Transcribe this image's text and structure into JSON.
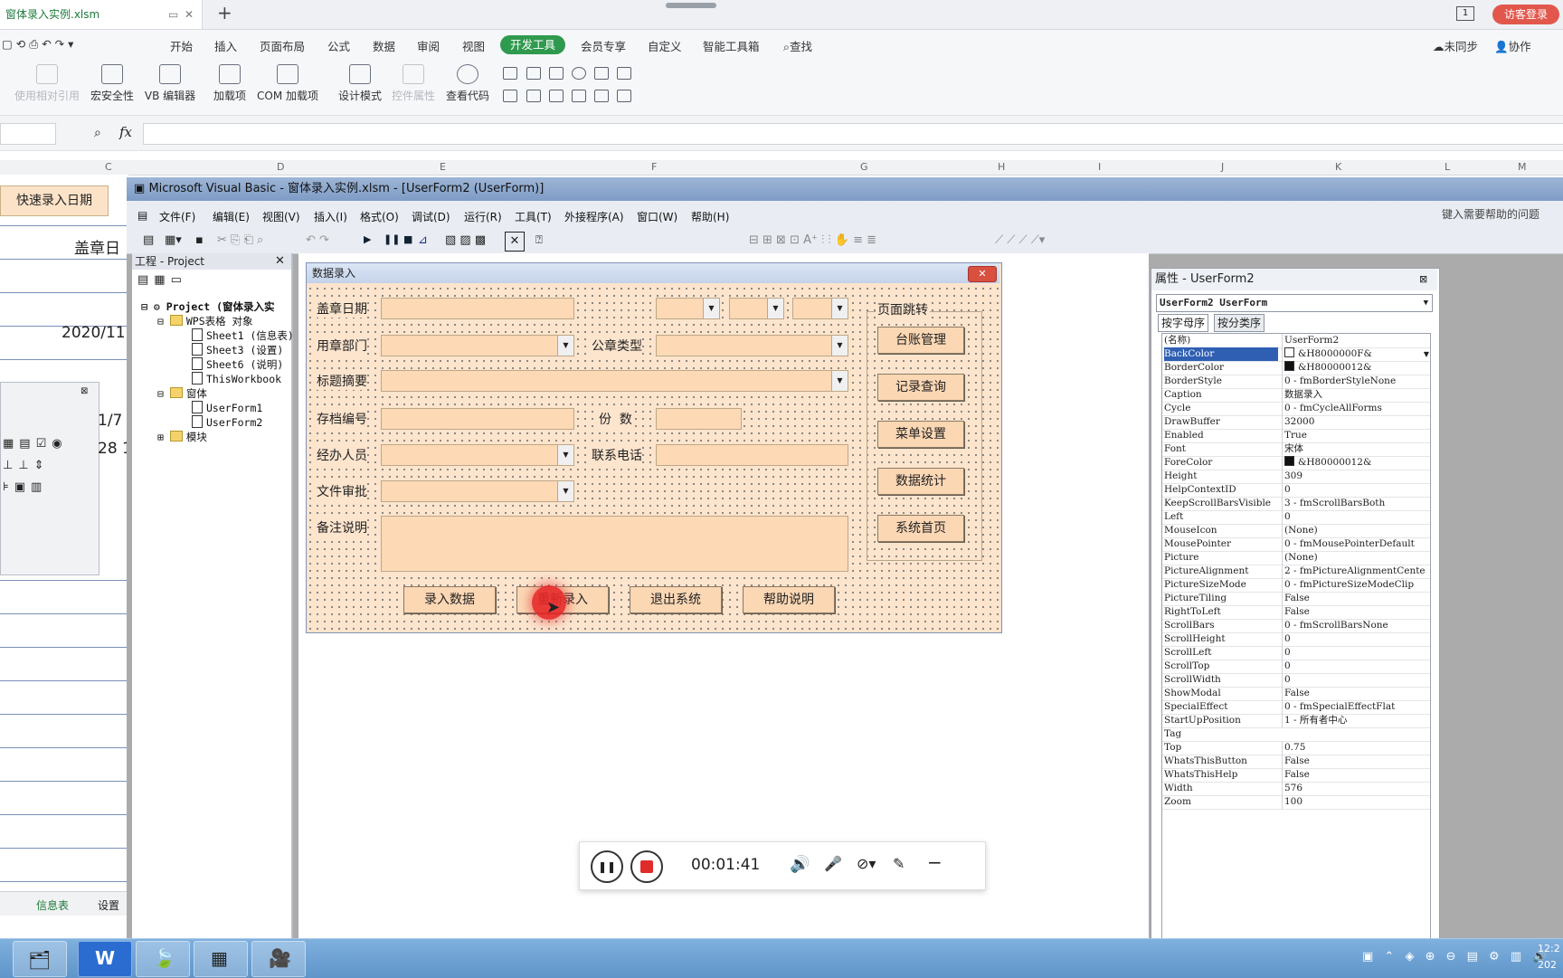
{
  "wps": {
    "tab_title": "窗体录入实例.xlsm",
    "guest_label": "访客登录",
    "window_count": "1",
    "menu": [
      "开始",
      "插入",
      "页面布局",
      "公式",
      "数据",
      "审阅",
      "视图"
    ],
    "menu_active": "开发工具",
    "menu_after": [
      "会员专享",
      "自定义",
      "智能工具箱"
    ],
    "search_label": "查找",
    "sync_label": "未同步",
    "collab_label": "协作",
    "ribbon": [
      {
        "label": "使用相对引用",
        "disabled": true
      },
      {
        "label": "宏安全性",
        "disabled": false
      },
      {
        "label": "VB 编辑器",
        "disabled": false
      },
      {
        "label": "加载项",
        "disabled": false
      },
      {
        "label": "COM 加载项",
        "disabled": false
      },
      {
        "label": "设计模式",
        "disabled": false
      },
      {
        "label": "控件属性",
        "disabled": true
      },
      {
        "label": "查看代码",
        "disabled": false
      }
    ],
    "fx_label": "fx",
    "columns": [
      "C",
      "D",
      "E",
      "F",
      "G",
      "H",
      "I",
      "J",
      "K",
      "L",
      "M"
    ],
    "sheet": {
      "quick_btn": "快速录入日期",
      "cell_header": "盖章日",
      "cell_date": "2020/11",
      "cell_partial1": "1/7",
      "cell_partial2": "28 1"
    },
    "sheet_tabs": [
      "信息表",
      "设置"
    ]
  },
  "vbe": {
    "title": "Microsoft Visual Basic - 窗体录入实例.xlsm - [UserForm2 (UserForm)]",
    "menu": [
      "文件(F)",
      "编辑(E)",
      "视图(V)",
      "插入(I)",
      "格式(O)",
      "调试(D)",
      "运行(R)",
      "工具(T)",
      "外接程序(A)",
      "窗口(W)",
      "帮助(H)"
    ],
    "help_placeholder": "键入需要帮助的问题",
    "project": {
      "title": "工程 - Project",
      "root": "Project (窗体录入实",
      "wps_objects": "WPS表格 对象",
      "sheets": [
        "Sheet1 (信息表)",
        "Sheet3 (设置)",
        "Sheet6 (说明)",
        "ThisWorkbook"
      ],
      "forms_folder": "窗体",
      "forms": [
        "UserForm1",
        "UserForm2"
      ],
      "modules_folder": "模块"
    }
  },
  "userform": {
    "caption": "数据录入",
    "close_glyph": "✕",
    "labels": {
      "seal_date": "盖章日期",
      "dept": "用章部门",
      "seal_type": "公章类型",
      "summary": "标题摘要",
      "archive_no": "存档编号",
      "copies": "份  数",
      "handler": "经办人员",
      "phone": "联系电话",
      "approval": "文件审批",
      "remarks": "备注说明"
    },
    "frame_caption": "页面跳转",
    "frame_buttons": [
      "台账管理",
      "记录查询",
      "菜单设置",
      "数据统计",
      "系统首页"
    ],
    "bottom_buttons": [
      "录入数据",
      "重新录入",
      "退出系统",
      "帮助说明"
    ]
  },
  "properties": {
    "title": "属性 - UserForm2",
    "object": "UserForm2 UserForm",
    "tabs": [
      "按字母序",
      "按分类序"
    ],
    "rows": [
      {
        "name": "(名称)",
        "value": "UserForm2"
      },
      {
        "name": "BackColor",
        "value": "&H8000000F&",
        "swatch": "#ffffff",
        "selected": true
      },
      {
        "name": "BorderColor",
        "value": "&H80000012&",
        "swatch": "#111111"
      },
      {
        "name": "BorderStyle",
        "value": "0 - fmBorderStyleNone"
      },
      {
        "name": "Caption",
        "value": "数据录入"
      },
      {
        "name": "Cycle",
        "value": "0 - fmCycleAllForms"
      },
      {
        "name": "DrawBuffer",
        "value": "32000"
      },
      {
        "name": "Enabled",
        "value": "True"
      },
      {
        "name": "Font",
        "value": "宋体"
      },
      {
        "name": "ForeColor",
        "value": "&H80000012&",
        "swatch": "#111111"
      },
      {
        "name": "Height",
        "value": "309"
      },
      {
        "name": "HelpContextID",
        "value": "0"
      },
      {
        "name": "KeepScrollBarsVisible",
        "value": "3 - fmScrollBarsBoth"
      },
      {
        "name": "Left",
        "value": "0"
      },
      {
        "name": "MouseIcon",
        "value": "(None)"
      },
      {
        "name": "MousePointer",
        "value": "0 - fmMousePointerDefault"
      },
      {
        "name": "Picture",
        "value": "(None)"
      },
      {
        "name": "PictureAlignment",
        "value": "2 - fmPictureAlignmentCente"
      },
      {
        "name": "PictureSizeMode",
        "value": "0 - fmPictureSizeModeClip"
      },
      {
        "name": "PictureTiling",
        "value": "False"
      },
      {
        "name": "RightToLeft",
        "value": "False"
      },
      {
        "name": "ScrollBars",
        "value": "0 - fmScrollBarsNone"
      },
      {
        "name": "ScrollHeight",
        "value": "0"
      },
      {
        "name": "ScrollLeft",
        "value": "0"
      },
      {
        "name": "ScrollTop",
        "value": "0"
      },
      {
        "name": "ScrollWidth",
        "value": "0"
      },
      {
        "name": "ShowModal",
        "value": "False"
      },
      {
        "name": "SpecialEffect",
        "value": "0 - fmSpecialEffectFlat"
      },
      {
        "name": "StartUpPosition",
        "value": "1 - 所有者中心"
      },
      {
        "name": "Tag",
        "value": ""
      },
      {
        "name": "Top",
        "value": "0.75"
      },
      {
        "name": "WhatsThisButton",
        "value": "False"
      },
      {
        "name": "WhatsThisHelp",
        "value": "False"
      },
      {
        "name": "Width",
        "value": "576"
      },
      {
        "name": "Zoom",
        "value": "100"
      }
    ]
  },
  "recorder": {
    "time": "00:01:41"
  },
  "taskbar": {
    "clock": "12:2",
    "year": "202"
  }
}
